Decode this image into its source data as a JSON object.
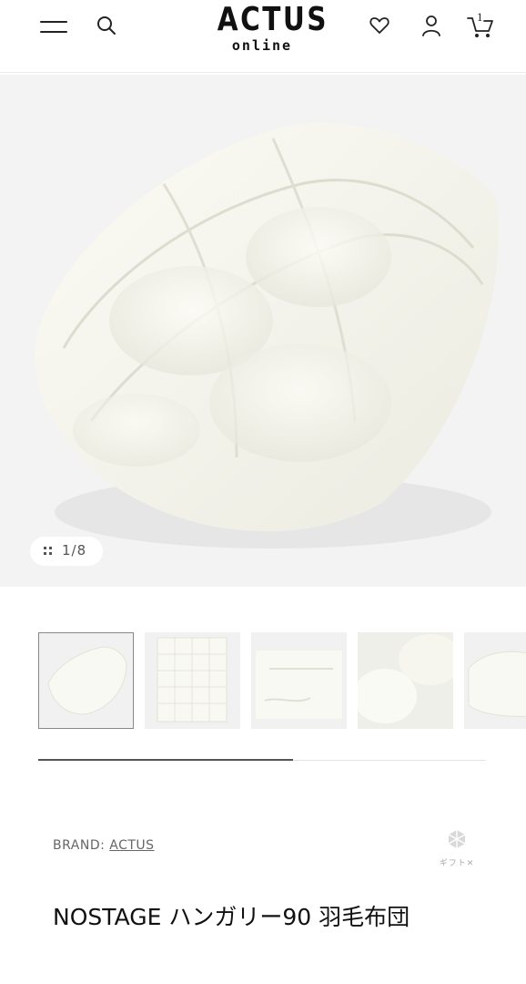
{
  "header": {
    "logo_main": "ACTUS",
    "logo_sub": "online",
    "cart_count": "1"
  },
  "gallery": {
    "counter": "1/8",
    "current_index": 1,
    "total": 8,
    "progress_fraction": 0.57
  },
  "product": {
    "brand_prefix": "BRAND:",
    "brand_name": "ACTUS",
    "gift_label": "ギフト✕",
    "title": "NOSTAGE ハンガリー90 羽毛布団"
  },
  "icons": [
    "menu-icon",
    "search-icon",
    "heart-icon",
    "user-icon",
    "cart-icon",
    "grid-icon",
    "gift-icon"
  ],
  "colors": {
    "text": "#222222",
    "muted": "#666666",
    "image_bg": "#f3f3f3",
    "accent": "#555555"
  }
}
